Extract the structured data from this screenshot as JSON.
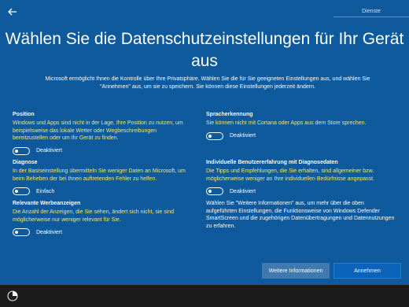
{
  "header": {
    "back_icon": "arrow-left-icon",
    "tab_label": "Dienste"
  },
  "title": "Wählen Sie die Datenschutzeinstellungen für Ihr Gerät aus",
  "intro": "Microsoft ermöglicht Ihnen die Kontrolle über Ihre Privatsphäre. Wählen Sie die für Sie geeigneten Einstellungen aus, und wählen Sie \"Annehmen\" aus, um sie zu speichern. Sie können diese Einstellungen jederzeit ändern.",
  "settings_left": [
    {
      "title": "Position",
      "desc": "Windows und Apps sind nicht in der Lage, Ihre Position zu nutzen, um beispielsweise das lokale Wetter oder Wegbeschreibungen bereitzustellen oder um Ihr Gerät zu finden.",
      "toggle": "Deaktiviert",
      "on": false
    },
    {
      "title": "Diagnose",
      "desc": "In der Basiseinstellung übermitteln Sie weniger Daten an Microsoft, um beim Beheben der bei Ihnen auftretenden Fehler zu helfen.",
      "toggle": "Einfach",
      "on": false
    },
    {
      "title": "Relevante Werbeanzeigen",
      "desc": "Die Anzahl der Anzeigen, die Sie sehen, ändert sich nicht, sie sind möglicherweise nur weniger relevant für Sie.",
      "toggle": "Deaktiviert",
      "on": false
    }
  ],
  "settings_right": [
    {
      "title": "Spracherkennung",
      "desc": "Sie können nicht mit Cortana oder Apps aus dem Store sprechen.",
      "toggle": "Deaktiviert",
      "on": false
    },
    {
      "title": "Individuelle Benutzererfahrung mit Diagnosedaten",
      "desc": "Die Tipps und Empfehlungen, die Sie erhalten, sind allgemeiner bzw. möglicherweise weniger an Ihre individuellen Bedürfnisse angepasst.",
      "toggle": "Deaktiviert",
      "on": false
    }
  ],
  "info_text": "Wählen Sie \"Weitere Informationen\" aus, um mehr über die oben aufgeführten Einstellungen, die Funktionsweise von Windows Defender SmartScreen und die zugehörigen Datenübertragungen und Datennutzungen zu erfahren.",
  "buttons": {
    "more": "Weitere Informationen",
    "accept": "Annehmen"
  },
  "footer": {
    "accessibility_icon": "ease-of-access-icon"
  },
  "colors": {
    "background": "#0e5a9c",
    "description_text": "#f2ea7a",
    "accept_button": "#0a63b8",
    "bottom_bar": "#1b1b1b"
  }
}
